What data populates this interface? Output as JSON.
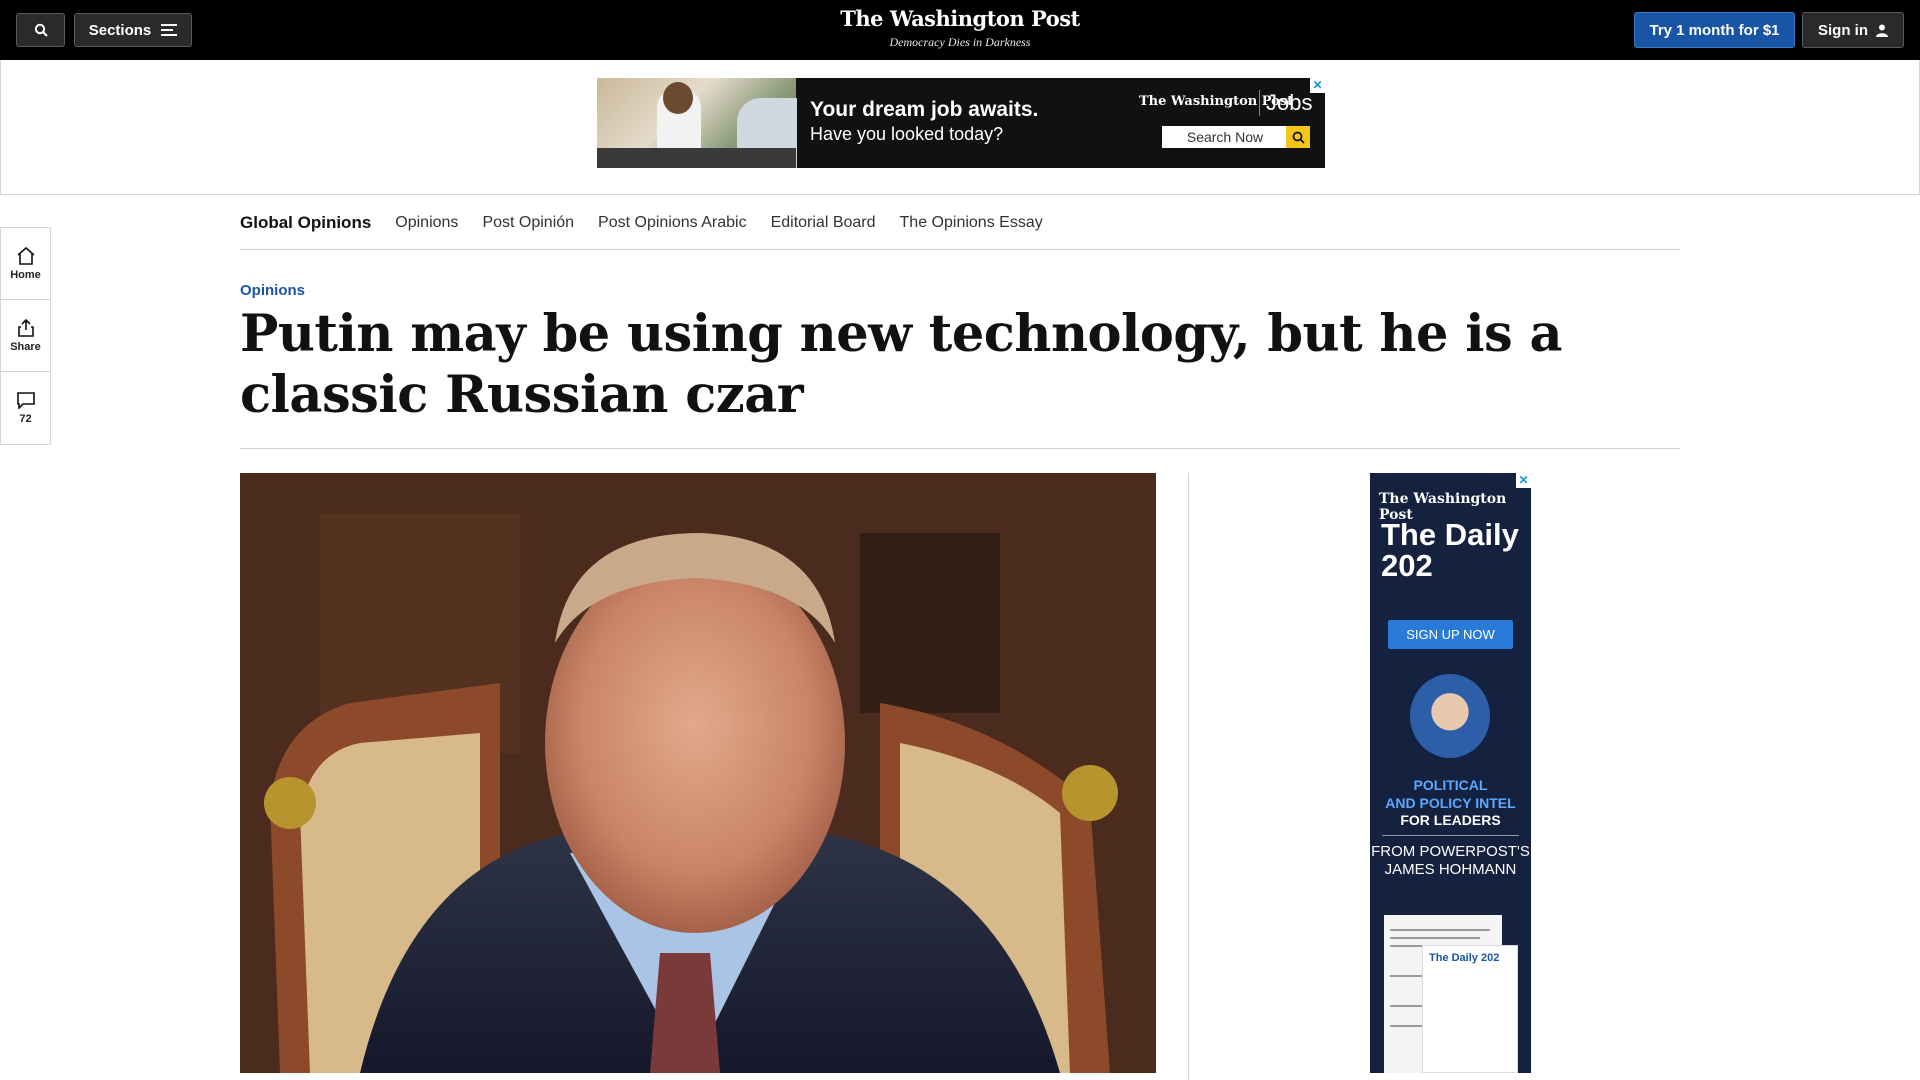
{
  "topbar": {
    "sections_label": "Sections",
    "brand_name": "The Washington Post",
    "brand_tagline": "Democracy Dies in Darkness",
    "try_label": "Try 1 month for $1",
    "signin_label": "Sign in"
  },
  "top_ad": {
    "headline": "Your dream job awaits.",
    "subline": "Have you looked today?",
    "brand": "The Washington Post",
    "product": "Jobs",
    "search_label": "Search Now",
    "close_glyph": "✕"
  },
  "rail": {
    "home_label": "Home",
    "share_label": "Share",
    "comments_count": "72"
  },
  "subnav": {
    "items": [
      "Global Opinions",
      "Opinions",
      "Post Opinión",
      "Post Opinions Arabic",
      "Editorial Board",
      "The Opinions Essay"
    ]
  },
  "article": {
    "kicker": "Opinions",
    "headline": "Putin may be using new technology, but he is a classic Russian czar"
  },
  "side_ad": {
    "brand": "The Washington Post",
    "title": "The Daily 202",
    "button": "SIGN UP NOW",
    "line1": "POLITICAL",
    "line2": "AND POLICY INTEL",
    "line3": "FOR LEADERS",
    "from": "FROM POWERPOST'S JAMES HOHMANN",
    "paper_title": "The Daily 202",
    "close_glyph": "✕"
  },
  "colors": {
    "topbar_bg": "#000000",
    "accent_blue": "#1955a5",
    "side_ad_bg": "#14213f"
  },
  "icons": [
    "search-icon",
    "menu-icon",
    "user-icon",
    "home-icon",
    "share-icon",
    "comment-icon",
    "magnifier-icon"
  ]
}
